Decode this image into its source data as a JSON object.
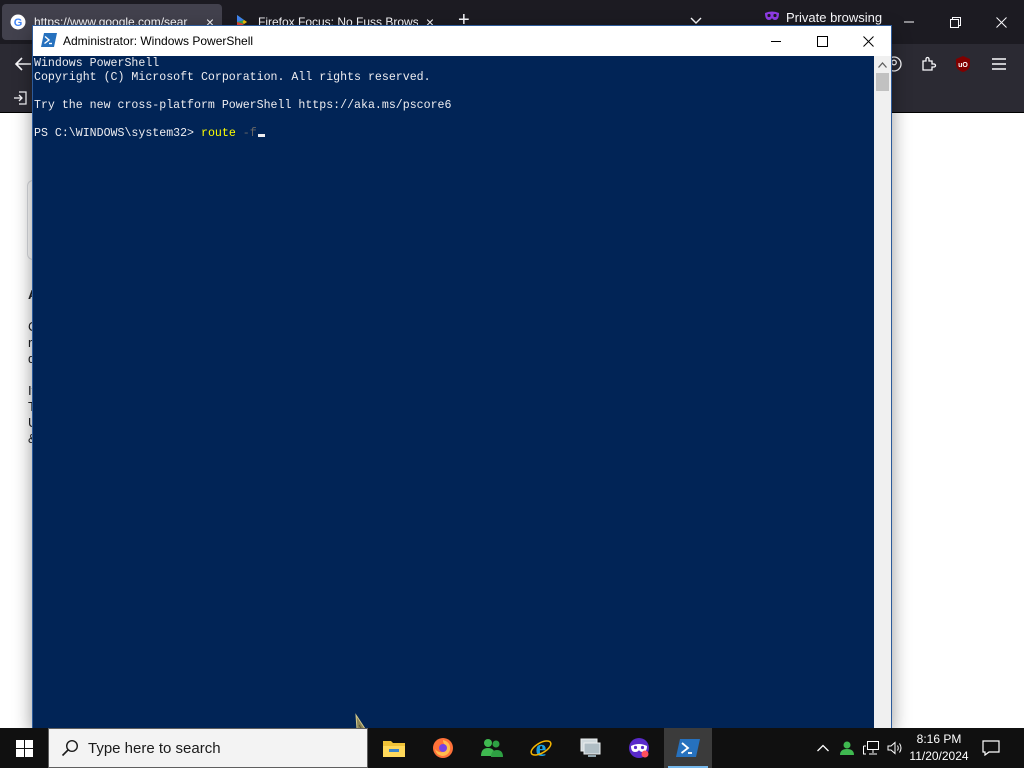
{
  "firefox": {
    "tabs": [
      {
        "label": "https://www.google.com/sear",
        "close": "×"
      },
      {
        "label": "Firefox Focus: No Fuss Browser",
        "close": "×"
      }
    ],
    "new_tab": "+",
    "private_label": "Private browsing",
    "page_fragments": [
      "A",
      "C",
      "r",
      "d",
      "If",
      "T",
      "U",
      "&"
    ]
  },
  "powershell": {
    "title": "Administrator: Windows PowerShell",
    "lines": [
      "Windows PowerShell",
      "Copyright (C) Microsoft Corporation. All rights reserved.",
      "Try the new cross-platform PowerShell https://aka.ms/pscore6"
    ],
    "prompt": "PS C:\\WINDOWS\\system32> ",
    "command": "route",
    "parameter": "-f"
  },
  "taskbar": {
    "search_placeholder": "Type here to search",
    "time": "8:16 PM",
    "date": "11/20/2024",
    "apps": [
      "file-explorer",
      "firefox",
      "people",
      "edge",
      "remote-desktop",
      "firefox-private",
      "powershell"
    ]
  },
  "colors": {
    "console_bg": "#012456",
    "console_text": "#eeedf0",
    "command": "#ffff00",
    "parameter": "#666666",
    "firefox_dark": "#1c1b22",
    "taskbar": "#101010"
  }
}
